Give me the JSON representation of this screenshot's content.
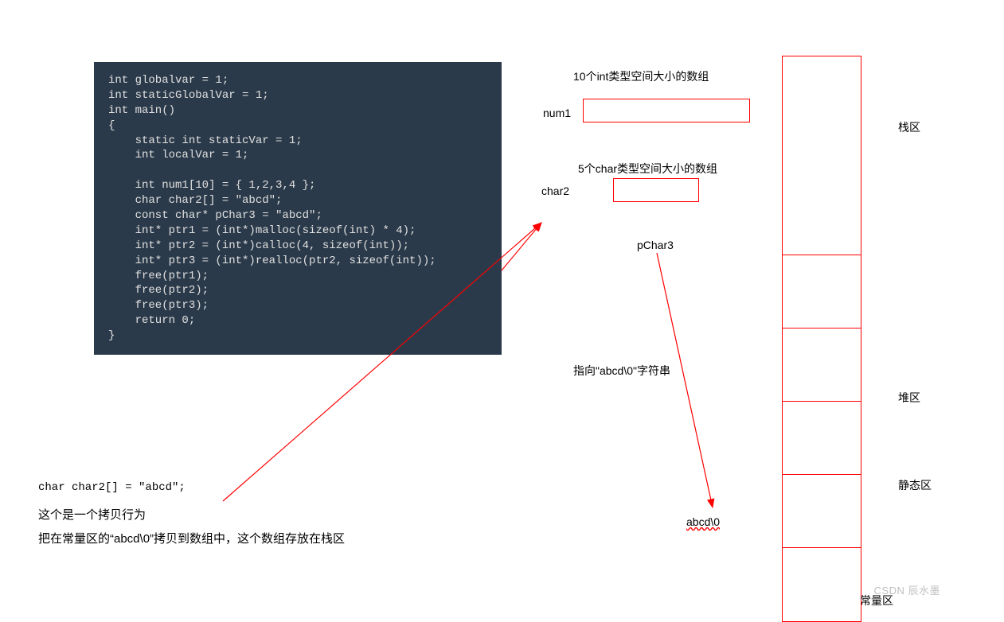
{
  "code": {
    "content": "int globalvar = 1;\nint staticGlobalVar = 1;\nint main()\n{\n    static int staticVar = 1;\n    int localVar = 1;\n\n    int num1[10] = { 1,2,3,4 };\n    char char2[] = \"abcd\";\n    const char* pChar3 = \"abcd\";\n    int* ptr1 = (int*)malloc(sizeof(int) * 4);\n    int* ptr2 = (int*)calloc(4, sizeof(int));\n    int* ptr3 = (int*)realloc(ptr2, sizeof(int));\n    free(ptr1);\n    free(ptr2);\n    free(ptr3);\n    return 0;\n}"
  },
  "labels": {
    "int_desc": "10个int类型空间大小的数组",
    "num1": "num1",
    "char_desc": "5个char类型空间大小的数组",
    "char2": "char2",
    "pChar3": "pChar3",
    "points_to": "指向\"abcd\\0\"字符串",
    "abcd": "abcd\\0"
  },
  "regions": {
    "stack": "栈区",
    "heap": "堆区",
    "static": "静态区",
    "const": "常量区"
  },
  "bottom": {
    "code_line": "char char2[] = \"abcd\";",
    "text1": "这个是一个拷贝行为",
    "text2": "把在常量区的“abcd\\0”拷贝到数组中，这个数组存放在栈区"
  },
  "watermark": "CSDN 辰水墨"
}
